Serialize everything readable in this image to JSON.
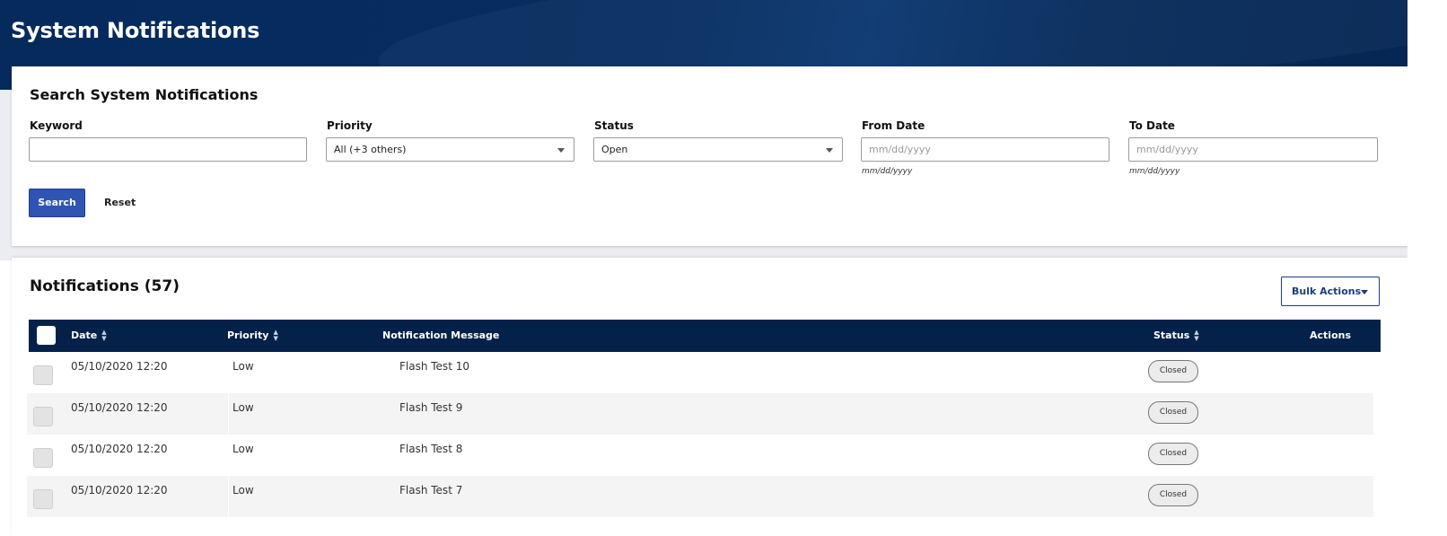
{
  "header": {
    "title": "System Notifications"
  },
  "search": {
    "title": "Search System Notifications",
    "keyword": {
      "label": "Keyword",
      "value": ""
    },
    "priority": {
      "label": "Priority",
      "value": "All (+3 others)"
    },
    "status": {
      "label": "Status",
      "value": "Open"
    },
    "from_date": {
      "label": "From Date",
      "placeholder": "mm/dd/yyyy",
      "hint": "mm/dd/yyyy"
    },
    "to_date": {
      "label": "To Date",
      "placeholder": "mm/dd/yyyy",
      "hint": "mm/dd/yyyy"
    },
    "search_label": "Search",
    "reset_label": "Reset"
  },
  "notifications": {
    "title": "Notifications (57)",
    "bulk_actions_label": "Bulk Actions",
    "columns": {
      "date": "Date",
      "priority": "Priority",
      "message": "Notification Message",
      "status": "Status",
      "actions": "Actions"
    },
    "rows": [
      {
        "date": "05/10/2020 12:20",
        "priority": "Low",
        "message": "Flash Test 10",
        "status": "Closed"
      },
      {
        "date": "05/10/2020 12:20",
        "priority": "Low",
        "message": "Flash Test 9",
        "status": "Closed"
      },
      {
        "date": "05/10/2020 12:20",
        "priority": "Low",
        "message": "Flash Test 8",
        "status": "Closed"
      },
      {
        "date": "05/10/2020 12:20",
        "priority": "Low",
        "message": "Flash Test 7",
        "status": "Closed"
      }
    ]
  },
  "colors": {
    "header_bg": "#062a5c",
    "table_header_bg": "#04214a",
    "primary_button": "#2f55b2"
  },
  "icons": {
    "sort": "sort-icon",
    "dropdown": "chevron-down-icon"
  }
}
